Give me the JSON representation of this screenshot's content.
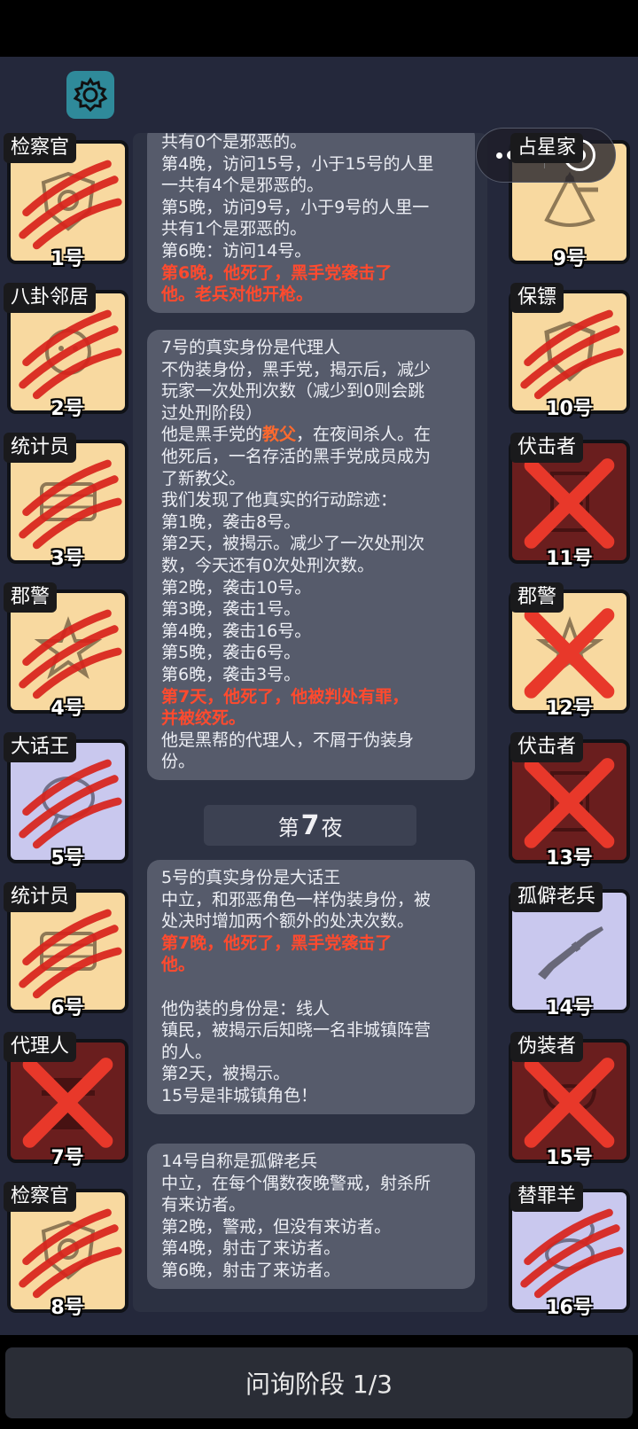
{
  "settings_icon": "gear-icon",
  "capsule": {
    "menu_icon": "more-dots-icon",
    "close_icon": "target-close-icon"
  },
  "players_left": [
    {
      "role": "检察官",
      "number": "1号",
      "bg": "cream",
      "icon": "shield-badge-icon",
      "status": "claw"
    },
    {
      "role": "八卦邻居",
      "number": "2号",
      "bg": "cream",
      "icon": "face-icon",
      "status": "claw"
    },
    {
      "role": "统计员",
      "number": "3号",
      "bg": "cream",
      "icon": "abacus-icon",
      "status": "claw"
    },
    {
      "role": "郡警",
      "number": "4号",
      "bg": "cream",
      "icon": "sheriff-star-icon",
      "status": "claw"
    },
    {
      "role": "大话王",
      "number": "5号",
      "bg": "lav",
      "icon": "speech-bubble-icon",
      "status": "claw"
    },
    {
      "role": "统计员",
      "number": "6号",
      "bg": "cream",
      "icon": "abacus-icon",
      "status": "claw"
    },
    {
      "role": "代理人",
      "number": "7号",
      "bg": "dark",
      "icon": "hat-man-icon",
      "status": "cross"
    },
    {
      "role": "检察官",
      "number": "8号",
      "bg": "cream",
      "icon": "shield-badge-icon",
      "status": "claw"
    }
  ],
  "players_right": [
    {
      "role": "占星家",
      "number": "9号",
      "bg": "cream",
      "icon": "sextant-icon",
      "status": "alive"
    },
    {
      "role": "保镖",
      "number": "10号",
      "bg": "cream",
      "icon": "shield-icon",
      "status": "claw"
    },
    {
      "role": "伏击者",
      "number": "11号",
      "bg": "dark",
      "icon": "door-icon",
      "status": "cross"
    },
    {
      "role": "郡警",
      "number": "12号",
      "bg": "cream",
      "icon": "sheriff-star-icon",
      "status": "cross"
    },
    {
      "role": "伏击者",
      "number": "13号",
      "bg": "dark",
      "icon": "door-icon",
      "status": "cross"
    },
    {
      "role": "孤僻老兵",
      "number": "14号",
      "bg": "lav",
      "icon": "rifle-icon",
      "status": "alive"
    },
    {
      "role": "伪装者",
      "number": "15号",
      "bg": "dark",
      "icon": "mask-icon",
      "status": "cross"
    },
    {
      "role": "替罪羊",
      "number": "16号",
      "bg": "lav",
      "icon": "goat-icon",
      "status": "claw"
    }
  ],
  "messages": {
    "m1": {
      "lines": [
        "共有0个是邪恶的。",
        "第4晚，访问15号，小于15号的人里",
        "一共有4个是邪恶的。",
        "第5晚，访问9号，小于9号的人里一",
        "共有1个是邪恶的。",
        "第6晚：访问14号。"
      ],
      "red": [
        "第6晚，他死了，黑手党袭击了",
        "他。老兵对他开枪。"
      ]
    },
    "m2": {
      "lines1": [
        "7号的真实身份是代理人",
        "不伪装身份，黑手党，揭示后，减少",
        "玩家一次处刑次数（减少到0则会跳",
        "过处刑阶段）"
      ],
      "godfather_pre": "他是黑手党的",
      "godfather_word": "教父",
      "godfather_post": "，在夜间杀人。在",
      "lines2": [
        "他死后，一名存活的黑手党成员成为",
        "了新教父。",
        "我们发现了他真实的行动踪迹：",
        "第1晚，袭击8号。",
        "第2天，被揭示。减少了一次处刑次",
        "数，今天还有0次处刑次数。",
        "第2晚，袭击10号。",
        "第3晚，袭击1号。",
        "第4晚，袭击16号。",
        "第5晚，袭击6号。",
        "第6晚，袭击3号。"
      ],
      "red": [
        "第7天，他死了，他被判处有罪，",
        "并被绞死。"
      ],
      "lines3": [
        "他是黑帮的代理人，不屑于伪装身",
        "份。"
      ]
    },
    "night": {
      "pre": "第",
      "num": "7",
      "post": "夜"
    },
    "m3": {
      "lines1": [
        "5号的真实身份是大话王",
        "中立，和邪恶角色一样伪装身份，被",
        "处决时增加两个额外的处决次数。"
      ],
      "red": [
        "第7晚，他死了，黑手党袭击了",
        "他。"
      ],
      "lines2": [
        "",
        "他伪装的身份是：线人",
        "镇民，被揭示后知晓一名非城镇阵营",
        "的人。",
        "第2天，被揭示。",
        "15号是非城镇角色！"
      ]
    },
    "m4": {
      "lines": [
        "14号自称是孤僻老兵",
        "中立，在每个偶数夜晚警戒，射杀所",
        "有来访者。",
        "第2晚，警戒，但没有来访者。",
        "第4晚，射击了来访者。",
        "第6晚，射击了来访者。"
      ]
    }
  },
  "phase": "问询阶段 1/3",
  "colors": {
    "accent_red": "#ff4a2e",
    "claw_red": "#d8231c",
    "settings_teal": "#2f8a9a"
  }
}
